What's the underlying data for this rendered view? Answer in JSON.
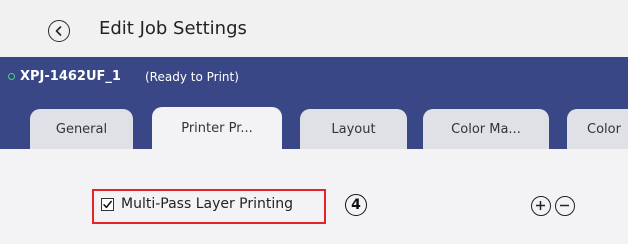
{
  "header": {
    "back_icon": "chevron-left-circle-icon",
    "title": "Edit Job Settings"
  },
  "printer": {
    "name": "XPJ-1462UF_1",
    "status": "(Ready to Print)",
    "status_color": "#49d07a"
  },
  "tabs": [
    {
      "label": "General",
      "active": false
    },
    {
      "label": "Printer Pr...",
      "active": true
    },
    {
      "label": "Layout",
      "active": false
    },
    {
      "label": "Color Ma...",
      "active": false
    },
    {
      "label": "Color",
      "active": false
    }
  ],
  "content": {
    "multipass_label": "Multi-Pass Layer Printing",
    "multipass_checked": true,
    "step_badge": "4",
    "add_icon": "plus-circle-icon",
    "remove_icon": "minus-circle-icon"
  },
  "colors": {
    "bar_bg": "#3a4786",
    "content_bg": "#f3f3f6",
    "callout": "#e3242b"
  }
}
